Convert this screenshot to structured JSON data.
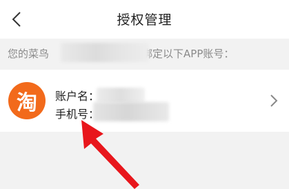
{
  "header": {
    "title": "授权管理",
    "back_icon": "chevron-left-icon"
  },
  "notice": {
    "prefix": "您的菜鸟",
    "suffix": "已绑定以下APP账号："
  },
  "account": {
    "app_logo_char": "淘",
    "app_logo_color": "#f26a1b",
    "name_label": "账户名：",
    "phone_label": "手机号：",
    "chevron_icon": "chevron-right-icon"
  },
  "annotation": {
    "arrow_color": "#e8161c",
    "arrow_icon": "red-arrow-icon"
  }
}
